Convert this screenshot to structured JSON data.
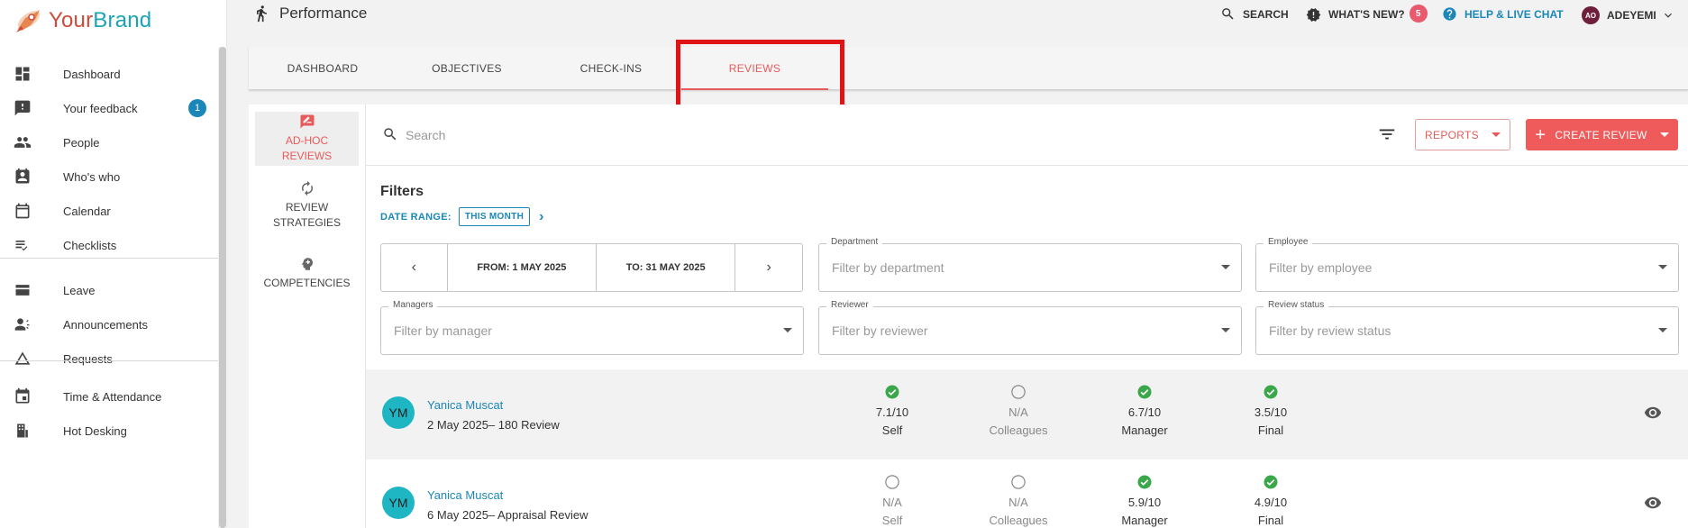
{
  "brand": {
    "name_a": "Your",
    "name_b": "Brand"
  },
  "sidebar": {
    "items": [
      {
        "label": "Dashboard",
        "icon": "dashboard-icon"
      },
      {
        "label": "Your feedback",
        "icon": "feedback-icon",
        "badge": "1"
      },
      {
        "label": "People",
        "icon": "people-icon"
      },
      {
        "label": "Who's who",
        "icon": "contact-icon"
      },
      {
        "label": "Calendar",
        "icon": "calendar-icon"
      },
      {
        "label": "Checklists",
        "icon": "checklist-icon"
      },
      {
        "label": "Leave",
        "icon": "leave-icon"
      },
      {
        "label": "Announcements",
        "icon": "announcement-icon"
      },
      {
        "label": "Requests",
        "icon": "requests-icon"
      },
      {
        "label": "Time & Attendance",
        "icon": "time-icon"
      },
      {
        "label": "Hot Desking",
        "icon": "hot-desk-icon"
      }
    ]
  },
  "header": {
    "title": "Performance",
    "search": "SEARCH",
    "whats_new": "WHAT'S NEW?",
    "whats_new_count": "5",
    "help": "HELP & LIVE CHAT",
    "user_initials": "AO",
    "user_name": "ADEYEMI"
  },
  "tabs": [
    "DASHBOARD",
    "OBJECTIVES",
    "CHECK-INS",
    "REVIEWS"
  ],
  "active_tab": "REVIEWS",
  "subnav": {
    "adhoc_line1": "AD-HOC",
    "adhoc_line2": "REVIEWS",
    "strategies_line1": "REVIEW",
    "strategies_line2": "STRATEGIES",
    "competencies": "COMPETENCIES"
  },
  "toolbar": {
    "search_placeholder": "Search",
    "reports_label": "REPORTS",
    "create_label": "CREATE REVIEW"
  },
  "filters": {
    "title": "Filters",
    "date_range_label": "DATE RANGE:",
    "date_range_value": "THIS MONTH",
    "from": "FROM: 1 MAY 2025",
    "to": "TO: 31 MAY 2025",
    "department": {
      "label": "Department",
      "placeholder": "Filter by department"
    },
    "employee": {
      "label": "Employee",
      "placeholder": "Filter by employee"
    },
    "managers": {
      "label": "Managers",
      "placeholder": "Filter by manager"
    },
    "reviewer": {
      "label": "Reviewer",
      "placeholder": "Filter by reviewer"
    },
    "review_status": {
      "label": "Review status",
      "placeholder": "Filter by review status"
    }
  },
  "reviews": [
    {
      "initials": "YM",
      "name": "Yanica Muscat",
      "description": "2 May 2025– 180 Review",
      "stats": [
        {
          "value": "7.1/10",
          "label": "Self",
          "done": true
        },
        {
          "value": "N/A",
          "label": "Colleagues",
          "done": false
        },
        {
          "value": "6.7/10",
          "label": "Manager",
          "done": true
        },
        {
          "value": "3.5/10",
          "label": "Final",
          "done": true
        }
      ]
    },
    {
      "initials": "YM",
      "name": "Yanica Muscat",
      "description": "6 May 2025– Appraisal Review",
      "stats": [
        {
          "value": "N/A",
          "label": "Self",
          "done": false
        },
        {
          "value": "N/A",
          "label": "Colleagues",
          "done": false
        },
        {
          "value": "5.9/10",
          "label": "Manager",
          "done": true
        },
        {
          "value": "4.9/10",
          "label": "Final",
          "done": true
        }
      ]
    }
  ],
  "colors": {
    "accent": "#ef5b5b",
    "link": "#1a87b8",
    "success": "#3aa84a",
    "annotation": "#e01414"
  }
}
